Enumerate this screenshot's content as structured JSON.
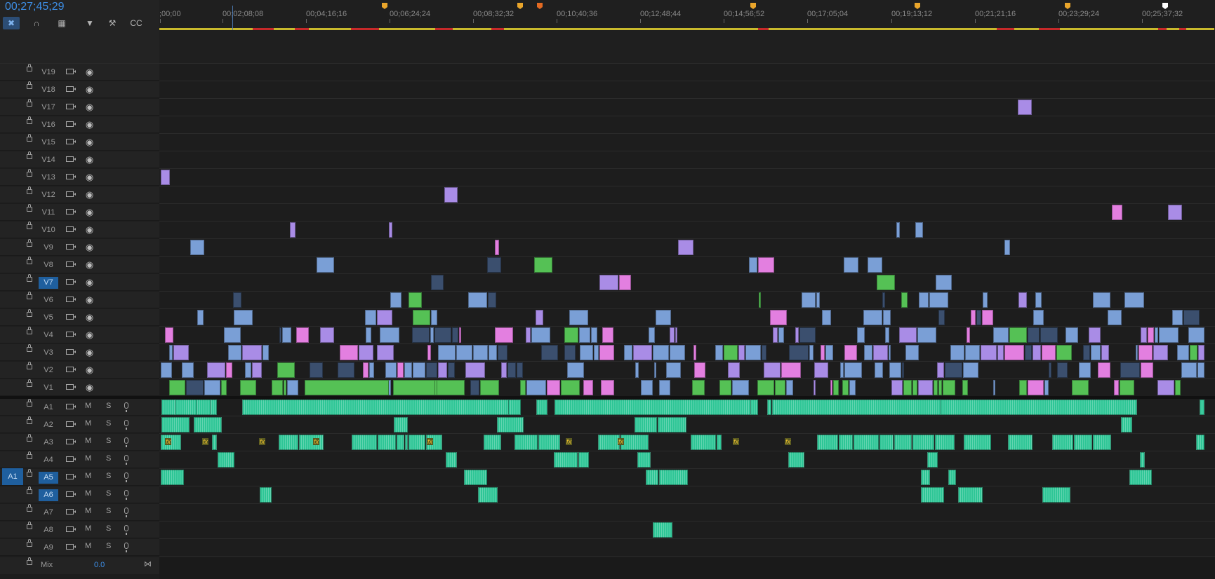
{
  "timecode": "00;27;45;29",
  "tools": [
    {
      "name": "snap-icon",
      "glyph": "✖",
      "active": true
    },
    {
      "name": "linked-selection-icon",
      "glyph": "∩",
      "active": false
    },
    {
      "name": "nest-icon",
      "glyph": "▦",
      "active": false
    },
    {
      "name": "marker-icon",
      "glyph": "▼",
      "active": false
    },
    {
      "name": "wrench-icon",
      "glyph": "⚒",
      "active": false
    },
    {
      "name": "captions-icon",
      "glyph": "CC",
      "active": false
    }
  ],
  "ruler": {
    "labels": [
      ";00;00",
      "00;02;08;08",
      "00;04;16;16",
      "00;06;24;24",
      "00;08;32;32",
      "00;10;40;36",
      "00;12;48;44",
      "00;14;56;52",
      "00;17;05;04",
      "00;19;13;12",
      "00;21;21;16",
      "00;23;29;24",
      "00;25;37;32"
    ],
    "marker_colors": [
      "#e9a52b",
      "#e9a52b",
      "#e36a22",
      "#e9a52b",
      "#e9a52b",
      "#e9a52b",
      "#ffffff"
    ]
  },
  "video_tracks": [
    "V19",
    "V18",
    "V17",
    "V16",
    "V15",
    "V14",
    "V13",
    "V12",
    "V11",
    "V10",
    "V9",
    "V8",
    "V7",
    "V6",
    "V5",
    "V4",
    "V3",
    "V2",
    "V1"
  ],
  "audio_tracks": [
    "A1",
    "A2",
    "A3",
    "A4",
    "A5",
    "A6",
    "A7",
    "A8",
    "A9"
  ],
  "selected_tracks": [
    "V7",
    "A5",
    "A6"
  ],
  "source_patch": "A1",
  "audio_buttons": {
    "mute": "M",
    "solo": "S"
  },
  "mix": {
    "label": "Mix",
    "value": "0.0"
  },
  "colors": {
    "timecode": "#3d8ee6",
    "clip_blue": "#7a9fd6",
    "clip_blue_dark": "#3b4f6e",
    "clip_pink": "#e37fe0",
    "clip_violet": "#a98ce6",
    "clip_green": "#55c155",
    "clip_audio": "#2ec696"
  }
}
